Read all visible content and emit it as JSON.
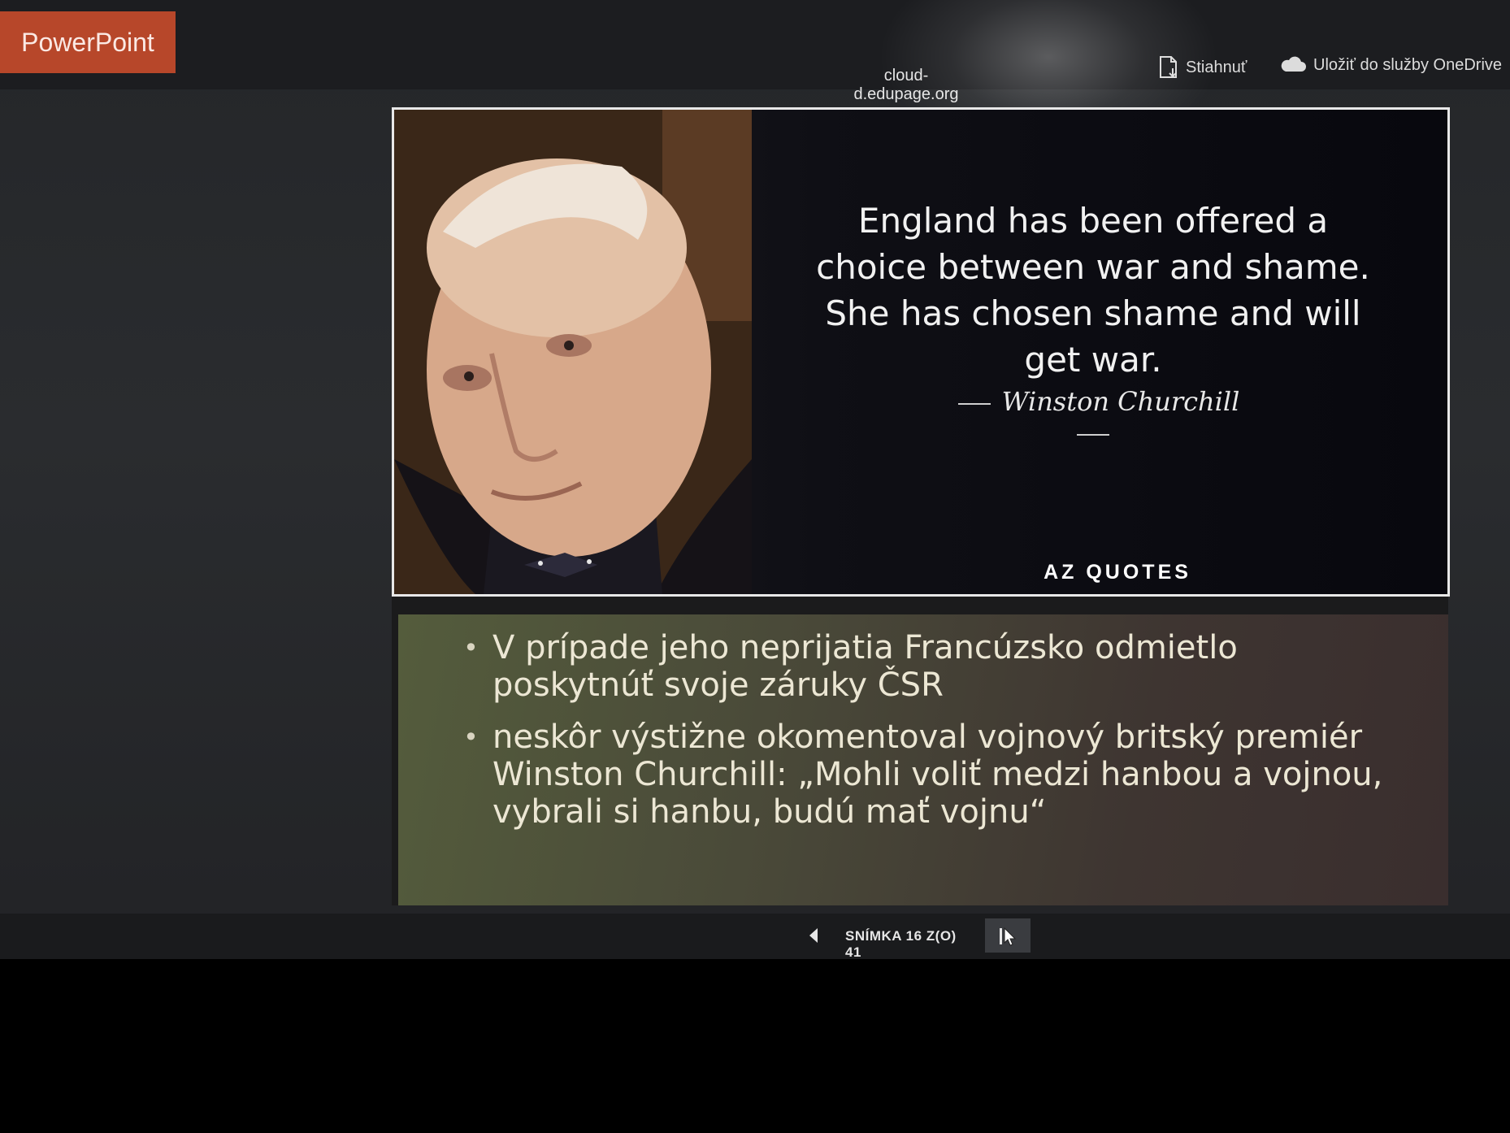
{
  "app": {
    "brand": "PowerPoint",
    "domain": "cloud-d.edupage.org"
  },
  "toolbar": {
    "download_label": "Stiahnuť",
    "onedrive_label": "Uložiť do služby OneDrive"
  },
  "slide": {
    "quote": "England has been offered a choice between war and shame. She has chosen shame and will get war.",
    "author": "Winston Churchill",
    "logo": "AZ QUOTES",
    "bullets": [
      "V prípade jeho neprijatia Francúzsko odmietlo poskytnúť svoje záruky ČSR",
      "neskôr výstižne okomentoval vojnový britský premiér Winston Churchill: „Mohli voliť medzi hanbou a vojnou, vybrali si hanbu, budú mať vojnu“"
    ]
  },
  "status": {
    "slide_counter": "SNÍMKA 16 Z(O) 41",
    "current_slide": 16,
    "total_slides": 41
  },
  "icons": {
    "download": "document-download-icon",
    "onedrive": "cloud-icon",
    "prev": "triangle-left-icon",
    "next": "cursor-next-icon"
  },
  "colors": {
    "brand": "#b7472a",
    "bullets_bg_start": "#545c3c",
    "bullets_bg_end": "#3a2e2e"
  }
}
